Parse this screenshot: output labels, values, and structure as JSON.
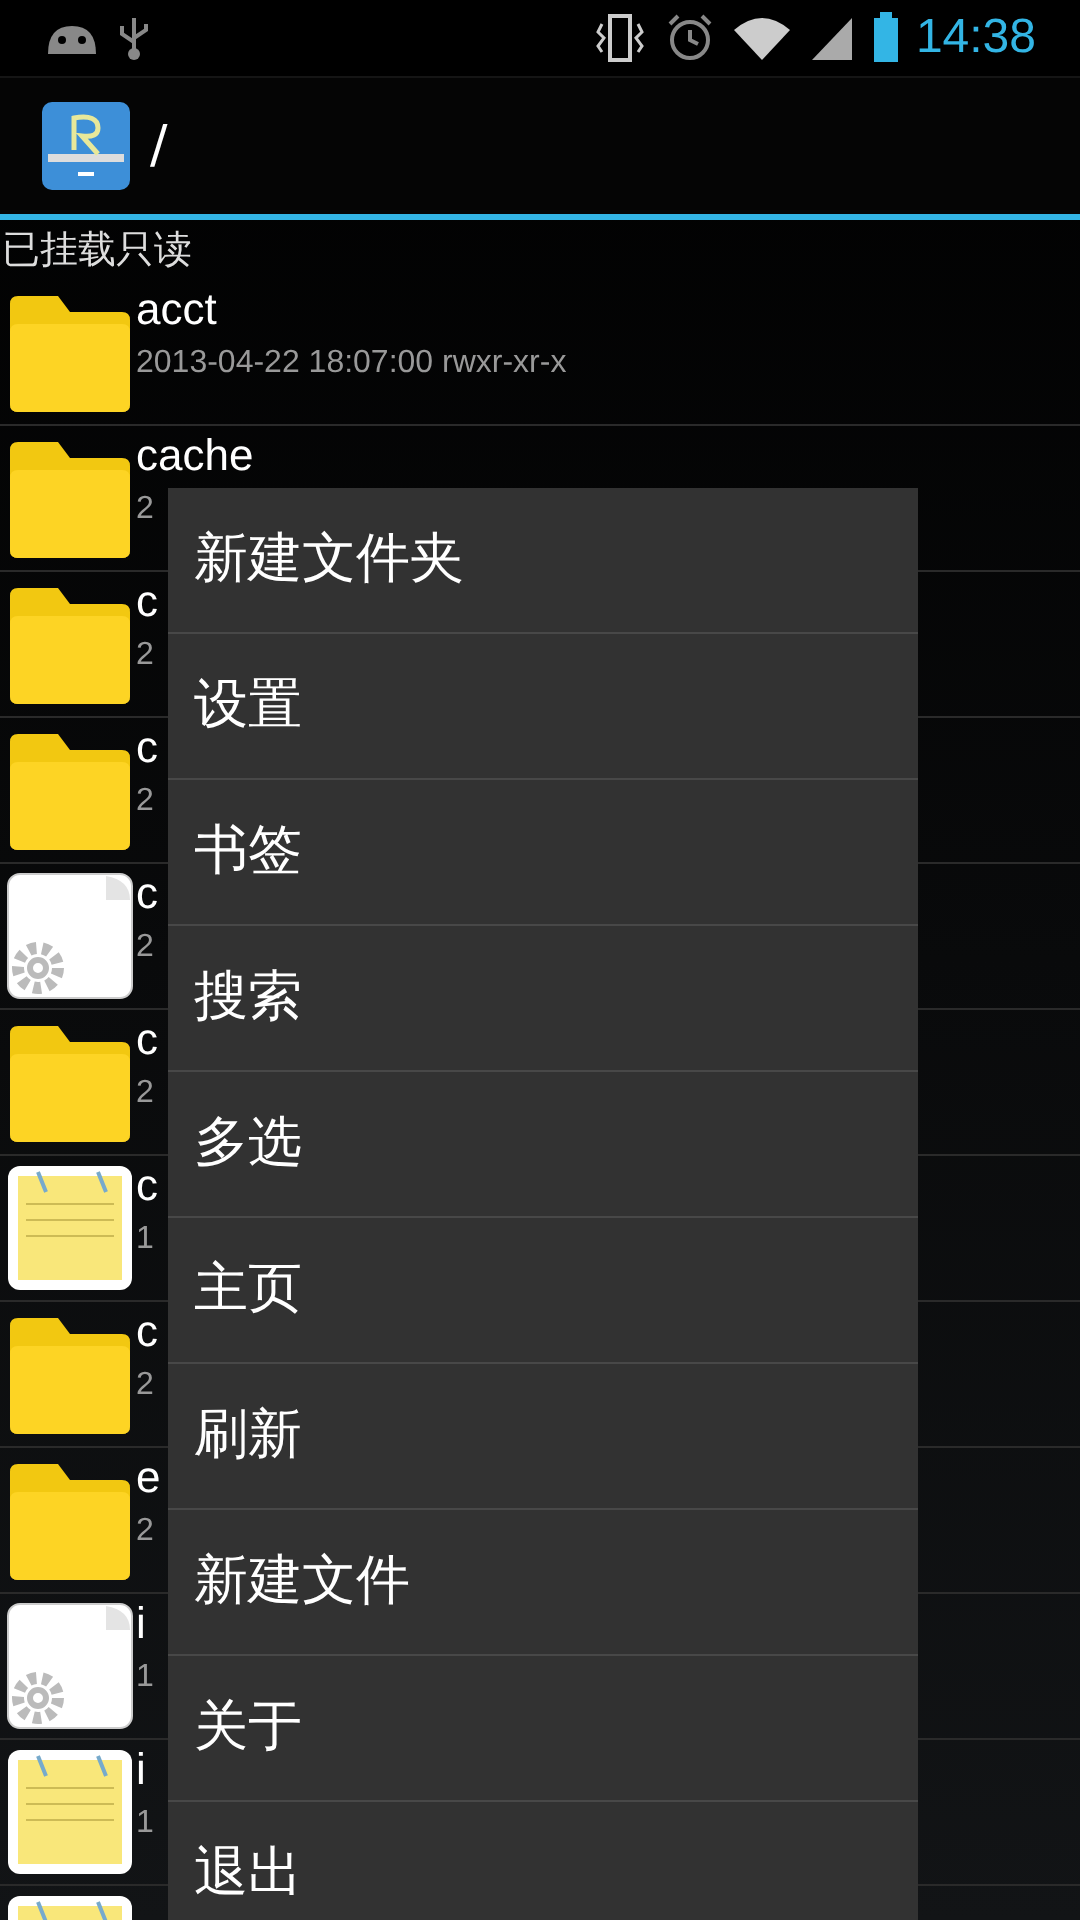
{
  "status_bar": {
    "time": "14:38"
  },
  "app_bar": {
    "path": "/"
  },
  "mount_status": "已挂载只读",
  "files": [
    {
      "kind": "folder",
      "name": "acct",
      "meta": "2013-04-22 18:07:00  rwxr-xr-x"
    },
    {
      "kind": "folder",
      "name": "cache",
      "meta": "2"
    },
    {
      "kind": "folder",
      "name": "c",
      "meta": "2"
    },
    {
      "kind": "folder",
      "name": "c",
      "meta": "2"
    },
    {
      "kind": "settings",
      "name": "c",
      "meta": "2"
    },
    {
      "kind": "folder",
      "name": "c",
      "meta": "2"
    },
    {
      "kind": "note",
      "name": "c",
      "meta": "1"
    },
    {
      "kind": "folder",
      "name": "c",
      "meta": "2"
    },
    {
      "kind": "folder",
      "name": "e",
      "meta": "2"
    },
    {
      "kind": "settings",
      "name": "i",
      "meta": "1"
    },
    {
      "kind": "note",
      "name": "i",
      "meta": "1"
    },
    {
      "kind": "note"
    }
  ],
  "menu": [
    "新建文件夹",
    "设置",
    "书签",
    "搜索",
    "多选",
    "主页",
    "刷新",
    "新建文件",
    "关于",
    "退出"
  ]
}
